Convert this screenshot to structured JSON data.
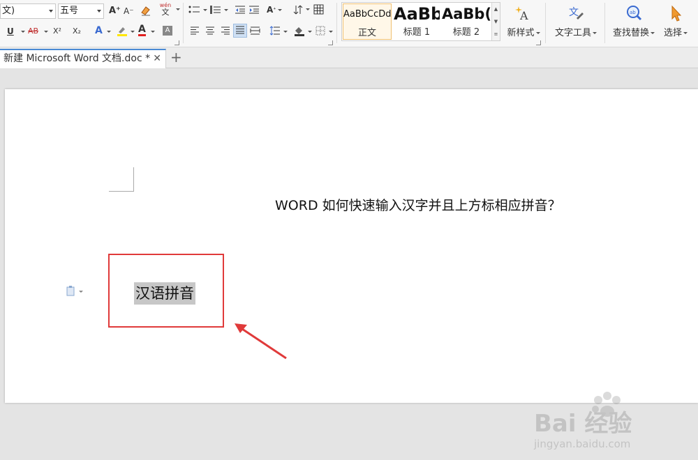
{
  "ribbon": {
    "font_name": "文)",
    "font_size": "五号",
    "styles": [
      {
        "sample": "AaBbCcDd",
        "name": "正文"
      },
      {
        "sample": "AaBb",
        "name": "标题 1"
      },
      {
        "sample": "AaBb(",
        "name": "标题 2"
      }
    ],
    "new_style": "新样式",
    "text_tools": "文字工具",
    "find_replace": "查找替换",
    "select": "选择",
    "pinyin_glyph_top": "wén",
    "pinyin_glyph_bottom": "文",
    "sup_label": "X²",
    "sub_label": "X₂",
    "strike_label": "AB",
    "underline_label": "U",
    "text_effect_label": "A",
    "font_color_label": "A",
    "char_shade_label": "A",
    "grow_font_label": "A⁺",
    "shrink_font_label": "A⁻"
  },
  "tabs": {
    "doc_name": "新建 Microsoft Word 文档.doc *",
    "close": "✕",
    "new": "+"
  },
  "document": {
    "title_line": "WORD 如何快速输入汉字并且上方标相应拼音？",
    "selected_text": "汉语拼音"
  },
  "watermark": {
    "brand": "Bai 经验",
    "url": "jingyan.baidu.com"
  },
  "colors": {
    "highlight_border": "#e03a3a",
    "selection_bg": "#c7c7c7",
    "accent": "#4a8ad4"
  }
}
